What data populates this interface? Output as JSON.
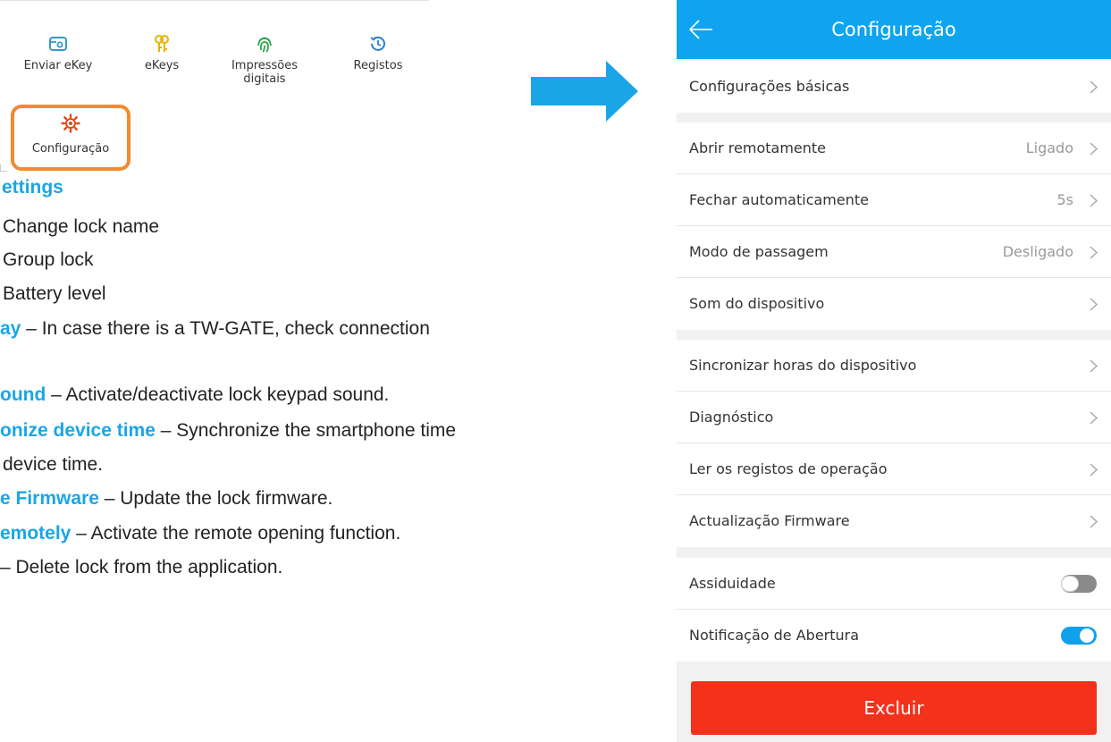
{
  "icon_grid": {
    "tiles": [
      {
        "label": "Enviar eKey",
        "icon": "send-key-icon",
        "color": "#3399cc"
      },
      {
        "label": "eKeys",
        "icon": "keys-icon",
        "color": "#e8b400"
      },
      {
        "label": "Impressões digitais",
        "icon": "fingerprint-icon",
        "color": "#2aa84a"
      },
      {
        "label": "Registos",
        "icon": "history-icon",
        "color": "#2a7fd0"
      },
      {
        "label": "Configuração",
        "icon": "gear-icon",
        "color": "#e04a1c"
      }
    ]
  },
  "doc": {
    "settings_heading": "ettings",
    "bullet_1": "Change lock name",
    "bullet_2": "Group lock",
    "bullet_3": "Battery level",
    "gateway_key": "ay",
    "gateway_text": " – In case there is a TW-GATE, check connection",
    "sound_key": "ound",
    "sound_text": " – Activate/deactivate lock keypad sound.",
    "sync_key": "onize device time",
    "sync_text": " – Synchronize the smartphone time",
    "sync_text_2": "device time.",
    "firmware_key": "e Firmware",
    "firmware_text": " – Update the lock firmware.",
    "remote_key": "emotely",
    "remote_text": " – Activate the remote opening function.",
    "delete_text": " – Delete lock from the application."
  },
  "phone": {
    "title": "Configuração",
    "basic_settings": "Configurações básicas",
    "remote_open": {
      "label": "Abrir remotamente",
      "value": "Ligado"
    },
    "auto_lock": {
      "label": "Fechar automaticamente",
      "value": "5s"
    },
    "passage_mode": {
      "label": "Modo de passagem",
      "value": "Desligado"
    },
    "device_sound": "Som do dispositivo",
    "sync_time": "Sincronizar horas do dispositivo",
    "diagnostics": "Diagnóstico",
    "read_logs": "Ler os registos de operação",
    "firmware_update": "Actualização Firmware",
    "attendance": {
      "label": "Assiduidade",
      "enabled": false
    },
    "unlock_notification": {
      "label": "Notificação de Abertura",
      "enabled": true
    },
    "delete_button": "Excluir",
    "colors": {
      "accent": "#0ea4ef",
      "danger": "#f4311b",
      "highlight_text": "#1aa6e6",
      "focus_border": "#f28a2e"
    }
  }
}
